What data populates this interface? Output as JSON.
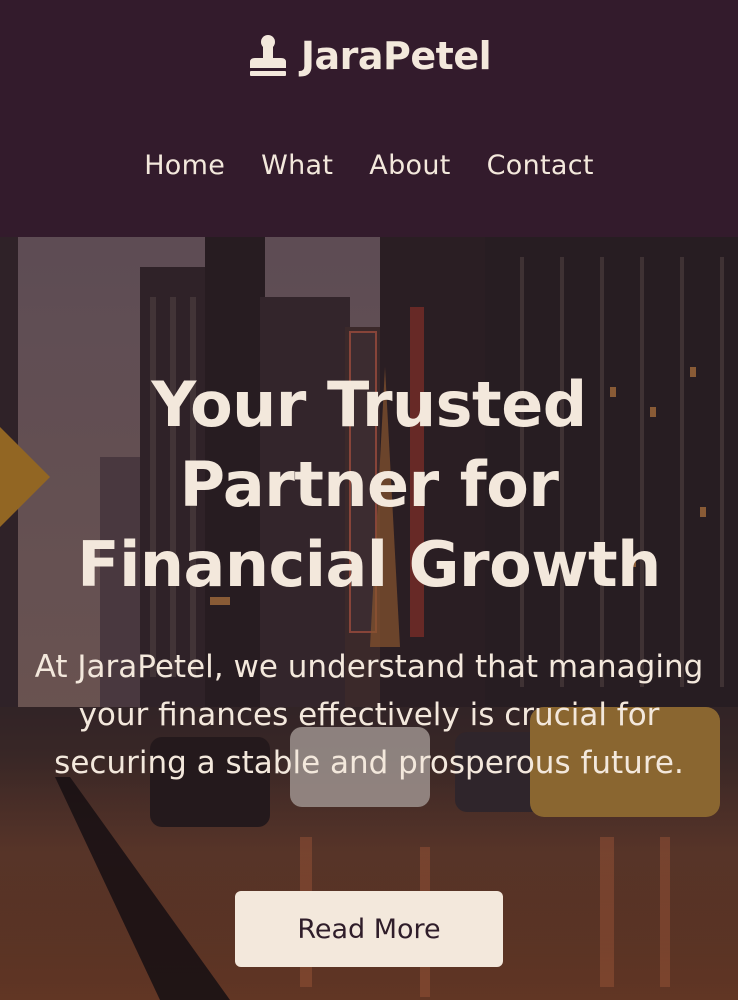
{
  "header": {
    "brand_name": "JaraPetel",
    "brand_icon": "stamp-icon",
    "nav": [
      {
        "label": "Home"
      },
      {
        "label": "What"
      },
      {
        "label": "About"
      },
      {
        "label": "Contact"
      }
    ]
  },
  "hero": {
    "title": "Your Trusted Partner for Financial Growth",
    "text": "At JaraPetel, we understand that managing your finances effectively is crucial for securing a stable and prosperous future.",
    "button_label": "Read More",
    "background_image": "city-street-at-dusk-image"
  },
  "colors": {
    "header_bg": "#331b2c",
    "text_light": "#f3e8dc",
    "button_bg": "#f3e8dc",
    "button_text": "#2f1d2a"
  }
}
